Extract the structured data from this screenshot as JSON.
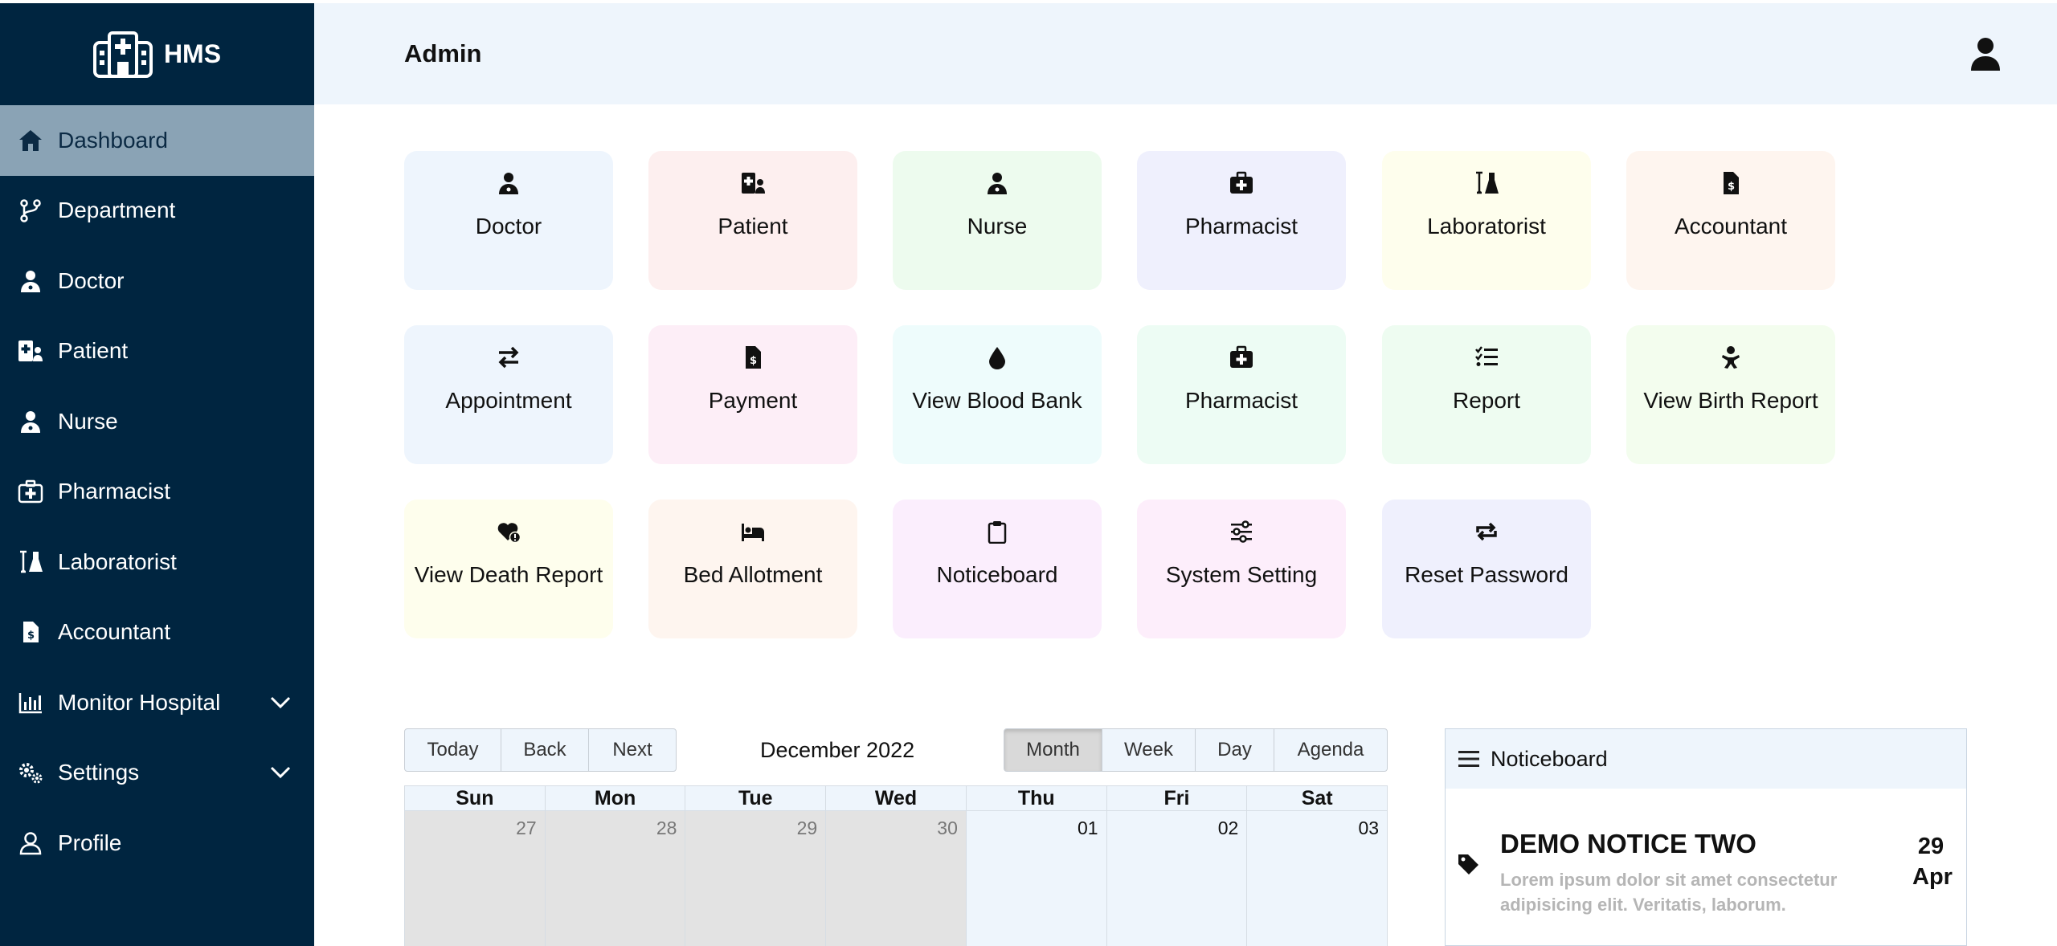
{
  "brand": {
    "name": "HMS"
  },
  "sidebar": {
    "items": [
      {
        "label": "Dashboard",
        "icon": "home-icon"
      },
      {
        "label": "Department",
        "icon": "branch-icon"
      },
      {
        "label": "Doctor",
        "icon": "doctor-icon"
      },
      {
        "label": "Patient",
        "icon": "patient-icon"
      },
      {
        "label": "Nurse",
        "icon": "nurse-icon"
      },
      {
        "label": "Pharmacist",
        "icon": "medkit-icon"
      },
      {
        "label": "Laboratorist",
        "icon": "flask-icon"
      },
      {
        "label": "Accountant",
        "icon": "invoice-icon"
      },
      {
        "label": "Monitor Hospital",
        "icon": "chart-icon"
      },
      {
        "label": "Settings",
        "icon": "gears-icon"
      },
      {
        "label": "Profile",
        "icon": "user-icon"
      }
    ]
  },
  "header": {
    "title": "Admin"
  },
  "tiles": [
    {
      "label": "Doctor",
      "icon": "doctor-icon",
      "color": "#eef5fd"
    },
    {
      "label": "Patient",
      "icon": "patient-icon",
      "color": "#fdefef"
    },
    {
      "label": "Nurse",
      "icon": "nurse-icon",
      "color": "#edfbee"
    },
    {
      "label": "Pharmacist",
      "icon": "medkit-icon",
      "color": "#eff0fd"
    },
    {
      "label": "Laboratorist",
      "icon": "flask-icon",
      "color": "#fefeed"
    },
    {
      "label": "Accountant",
      "icon": "invoice-icon",
      "color": "#fef5ef"
    },
    {
      "label": "Appointment",
      "icon": "swap-icon",
      "color": "#eef5fd"
    },
    {
      "label": "Payment",
      "icon": "invoice-icon",
      "color": "#fdeef7"
    },
    {
      "label": "View Blood Bank",
      "icon": "droplet-icon",
      "color": "#eefcfc"
    },
    {
      "label": "Pharmacist",
      "icon": "medkit-icon",
      "color": "#edfcf4"
    },
    {
      "label": "Report",
      "icon": "checklist-icon",
      "color": "#eefcf1"
    },
    {
      "label": "View Birth Report",
      "icon": "baby-icon",
      "color": "#f3fdee"
    },
    {
      "label": "View Death Report",
      "icon": "heart-alert-icon",
      "color": "#fefeed"
    },
    {
      "label": "Bed Allotment",
      "icon": "bed-icon",
      "color": "#fef5ef"
    },
    {
      "label": "Noticeboard",
      "icon": "clipboard-icon",
      "color": "#fbeefd"
    },
    {
      "label": "System Setting",
      "icon": "sliders-icon",
      "color": "#fdeefb"
    },
    {
      "label": "Reset Password",
      "icon": "repeat-icon",
      "color": "#eff0fd"
    }
  ],
  "calendar": {
    "nav_buttons": [
      "Today",
      "Back",
      "Next"
    ],
    "label": "December 2022",
    "view_buttons": [
      "Month",
      "Week",
      "Day",
      "Agenda"
    ],
    "active_view": "Month",
    "weekdays": [
      "Sun",
      "Mon",
      "Tue",
      "Wed",
      "Thu",
      "Fri",
      "Sat"
    ],
    "first_week": [
      "27",
      "28",
      "29",
      "30",
      "01",
      "02",
      "03"
    ]
  },
  "noticeboard": {
    "title": "Noticeboard",
    "items": [
      {
        "title": "DEMO NOTICE TWO",
        "text": "Lorem ipsum dolor sit amet consectetur adipisicing elit. Veritatis, laborum.",
        "day": "29",
        "month": "Apr"
      }
    ]
  }
}
